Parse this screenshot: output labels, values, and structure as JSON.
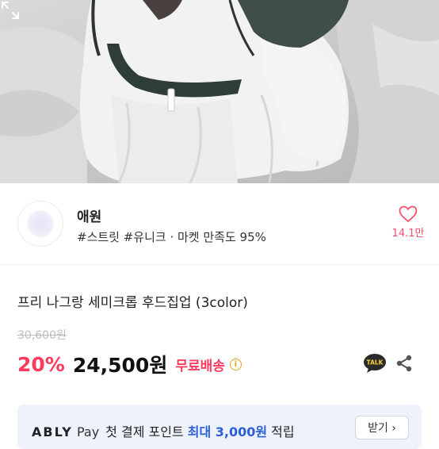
{
  "photo": {
    "expand_icon": "expand-arrows-icon"
  },
  "seller": {
    "name": "애원",
    "tags": "#스트릿 #유니크 · 마켓 만족도 95%",
    "favorite_icon": "heart-outline-icon",
    "favorite_count": "14.1만"
  },
  "product": {
    "title": "프리 나그랑 세미크롭 후드집업 (3color)",
    "original_price": "30,600원",
    "discount": "20%",
    "sale_price": "24,500원",
    "shipping": "무료배송",
    "shipping_info_icon": "info-icon",
    "talk_icon": "kakao-talk-icon",
    "share_icon": "share-icon"
  },
  "banner": {
    "brand": "ABLY",
    "pay": "Pay",
    "text_before": "첫 결제 포인트 ",
    "highlight": "최대 3,000원",
    "text_after": " 적립",
    "button_label": "받기 ›"
  },
  "colors": {
    "accent": "#ff3a5c",
    "banner_bg": "#eef3fb",
    "banner_highlight": "#2b5fd9"
  }
}
